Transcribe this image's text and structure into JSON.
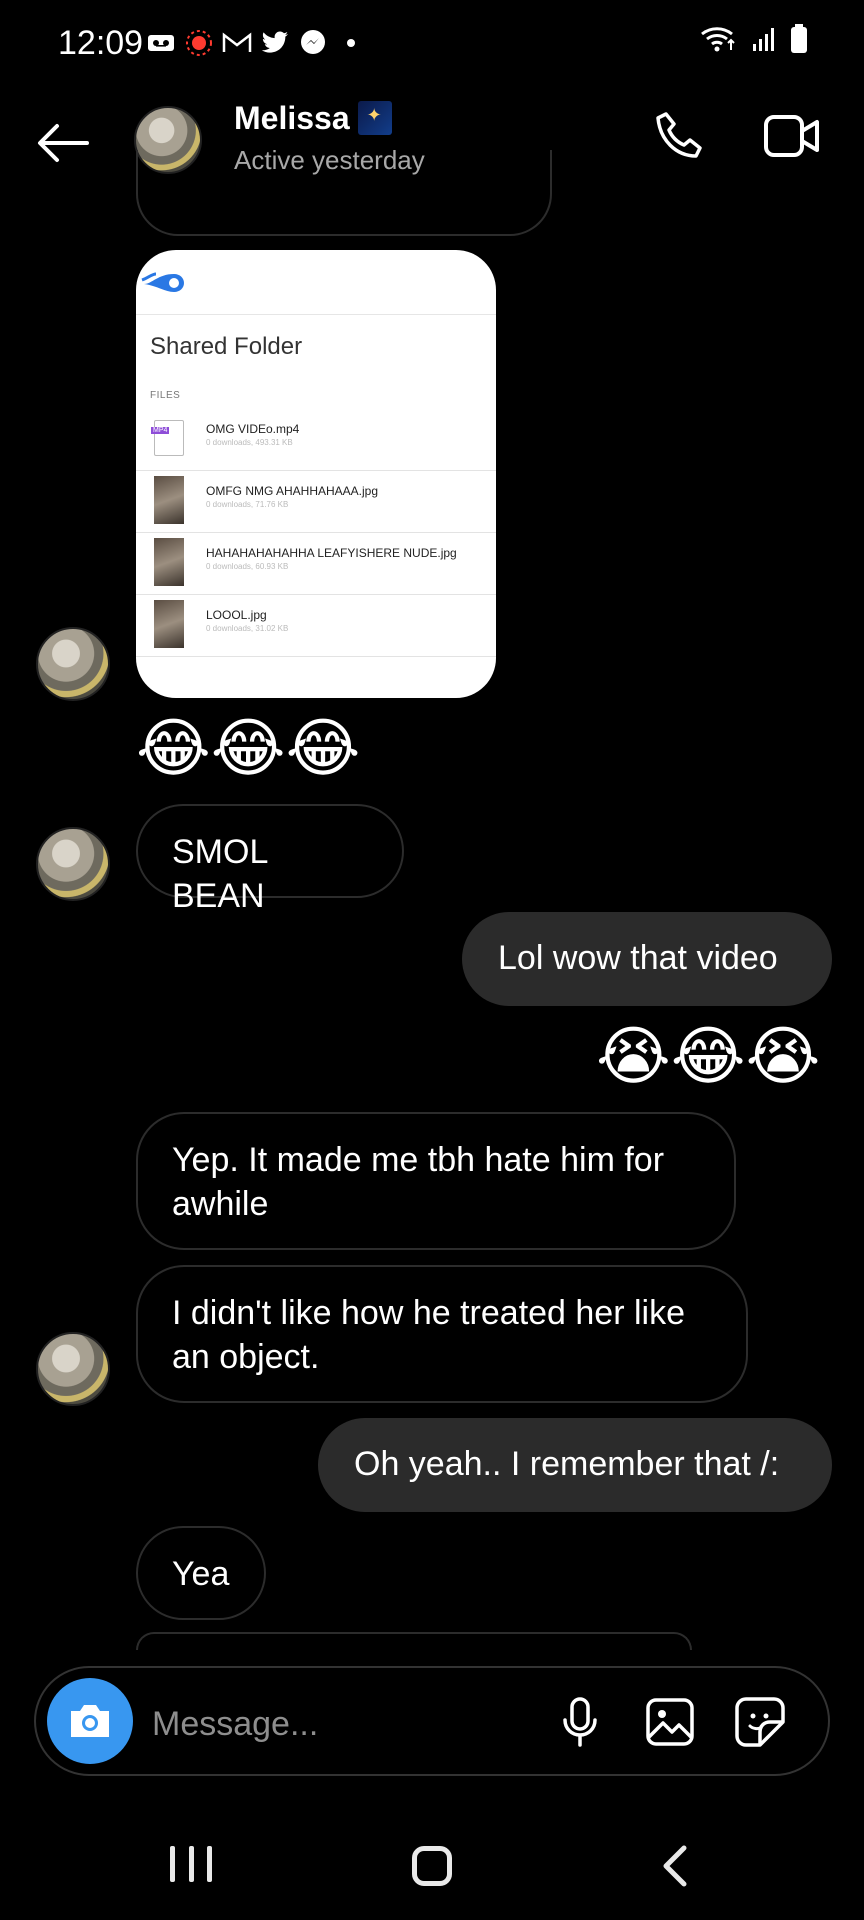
{
  "status_bar": {
    "time": "12:09",
    "left_icons": [
      "voicemail-icon",
      "recording-icon",
      "gmail-icon",
      "twitter-icon",
      "messenger-icon",
      "dot-icon"
    ],
    "right_icons": [
      "wifi-icon",
      "signal-icon",
      "battery-icon"
    ]
  },
  "header": {
    "contact_name": "Melissa",
    "contact_status": "Active yesterday",
    "icons": [
      "back-arrow-icon",
      "phone-icon",
      "video-camera-icon"
    ]
  },
  "shared_folder_card": {
    "title": "Shared Folder",
    "files_label": "FILES",
    "files": [
      {
        "name": "OMG VIDEo.mp4",
        "meta": "0 downloads, 493.31 KB",
        "type_tag": "MP4"
      },
      {
        "name": "OMFG NMG AHAHHAHAAA.jpg",
        "meta": "0 downloads, 71.76 KB"
      },
      {
        "name": "HAHAHAHAHAHHA LEAFYISHERE NUDE.jpg",
        "meta": "0 downloads, 60.93 KB"
      },
      {
        "name": "LOOOL.jpg",
        "meta": "0 downloads, 31.02 KB"
      }
    ]
  },
  "messages": {
    "emoji_in": "😂😂😂",
    "smol_bean": "SMOL BEAN",
    "lol_wow": "Lol wow that video",
    "emoji_out": "😭😂😭",
    "yep": "Yep. It made me tbh hate him for awhile",
    "didnt_like": "I didn't like how he treated her like an object.",
    "oh_yeah": "Oh yeah.. I remember that /:",
    "yea": "Yea"
  },
  "composer": {
    "placeholder": "Message..."
  },
  "colors": {
    "background": "#000000",
    "outgoing_bubble": "#2b2b2b",
    "incoming_border": "#2c2c2c",
    "camera_button": "#3897f0",
    "secondary_text": "#a8a8a8"
  }
}
